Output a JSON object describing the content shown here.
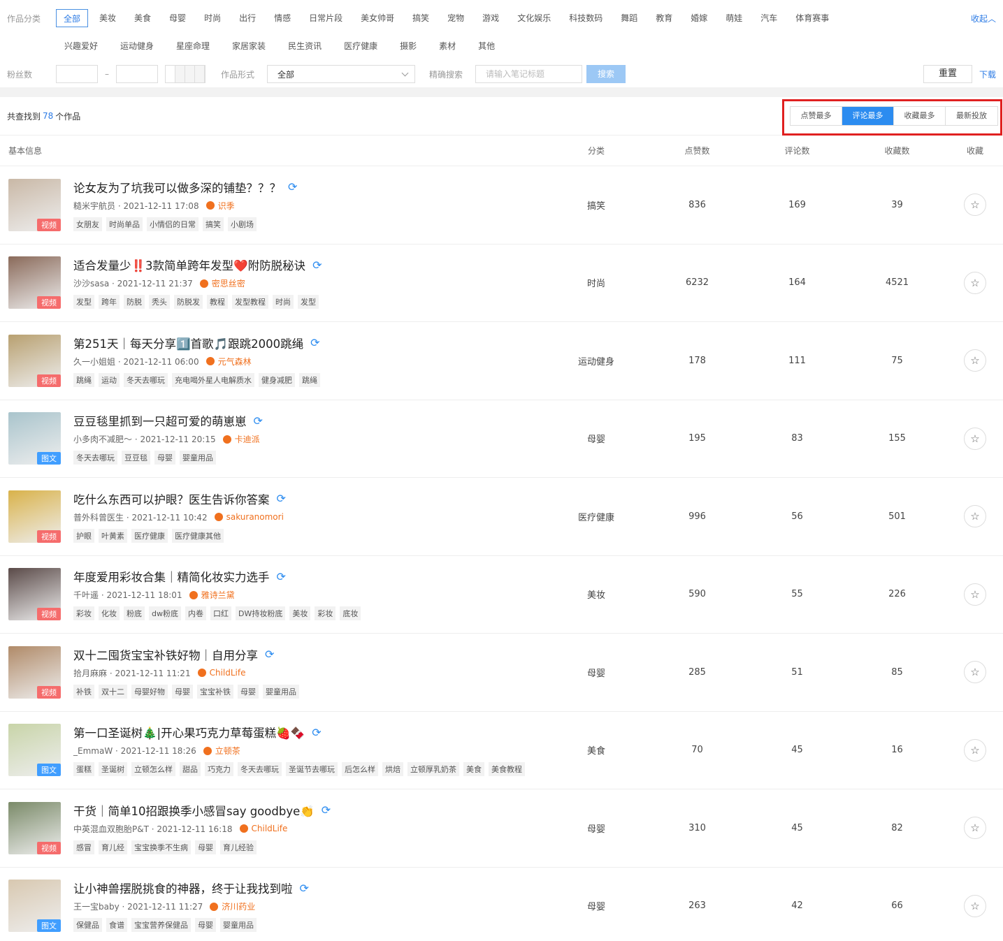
{
  "filter": {
    "category_label": "作品分类",
    "categories_row1": [
      "全部",
      "美妆",
      "美食",
      "母婴",
      "时尚",
      "出行",
      "情感",
      "日常片段",
      "美女帅哥",
      "搞笑",
      "宠物",
      "游戏",
      "文化娱乐",
      "科技数码",
      "舞蹈",
      "教育",
      "婚嫁",
      "萌娃",
      "汽车",
      "体育赛事"
    ],
    "categories_row2": [
      "兴趣爱好",
      "运动健身",
      "星座命理",
      "家居家装",
      "民生资讯",
      "医疗健康",
      "摄影",
      "素材",
      "其他"
    ],
    "active_category": "全部",
    "collapse_label": "收起︿",
    "fans_label": "粉丝数",
    "fans_min": "",
    "fans_max": "",
    "dash": "–",
    "form_label": "作品形式",
    "form_value": "全部",
    "precise_label": "精确搜索",
    "search_placeholder": "请输入笔记标题",
    "search_button": "搜索",
    "reset_button": "重置",
    "download_link": "下载"
  },
  "summary": {
    "prefix": "共查找到",
    "count": "78",
    "suffix": "个作品"
  },
  "sort": {
    "options": [
      "点赞最多",
      "评论最多",
      "收藏最多",
      "最新投放"
    ],
    "active": "评论最多"
  },
  "columns": [
    "基本信息",
    "分类",
    "点赞数",
    "评论数",
    "收藏数",
    "收藏"
  ],
  "rows": [
    {
      "title": "论女友为了坑我可以做多深的铺垫？？？",
      "author": "糙米宇航员 · 2021-12-11 17:08",
      "brand": "识季",
      "tags": [
        "女朋友",
        "时尚单品",
        "小情侣的日常",
        "搞笑",
        "小剧场"
      ],
      "category": "搞笑",
      "likes": "836",
      "comments": "169",
      "favorites": "39",
      "type": "视频",
      "thumb_color": "#c9b8a6"
    },
    {
      "title": "适合发量少‼️3款简单跨年发型❤️附防脱秘诀",
      "author": "沙沙sasa · 2021-12-11 21:37",
      "brand": "密思丝密",
      "tags": [
        "发型",
        "跨年",
        "防脱",
        "秃头",
        "防脱发",
        "教程",
        "发型教程",
        "时尚",
        "发型"
      ],
      "category": "时尚",
      "likes": "6232",
      "comments": "164",
      "favorites": "4521",
      "type": "视频",
      "thumb_color": "#8a6a5a"
    },
    {
      "title": "第251天｜每天分享1️⃣首歌🎵跟跳2000跳绳",
      "author": "久一小姐姐 · 2021-12-11 06:00",
      "brand": "元气森林",
      "tags": [
        "跳绳",
        "运动",
        "冬天去哪玩",
        "充电喝外星人电解质水",
        "健身减肥",
        "跳绳"
      ],
      "category": "运动健身",
      "likes": "178",
      "comments": "111",
      "favorites": "75",
      "type": "视频",
      "thumb_color": "#b8a070"
    },
    {
      "title": "豆豆毯里抓到一只超可爱的萌崽崽",
      "author": "小多肉不减肥～ · 2021-12-11 20:15",
      "brand": "卡迪派",
      "tags": [
        "冬天去哪玩",
        "豆豆毯",
        "母婴",
        "婴童用品"
      ],
      "category": "母婴",
      "likes": "195",
      "comments": "83",
      "favorites": "155",
      "type": "图文",
      "thumb_color": "#a9c4cc"
    },
    {
      "title": "吃什么东西可以护眼？医生告诉你答案",
      "author": "普外科曾医生 · 2021-12-11 10:42",
      "brand": "sakuranomori",
      "tags": [
        "护眼",
        "叶黄素",
        "医疗健康",
        "医疗健康其他"
      ],
      "category": "医疗健康",
      "likes": "996",
      "comments": "56",
      "favorites": "501",
      "type": "视频",
      "thumb_color": "#d9b24a"
    },
    {
      "title": "年度爱用彩妆合集｜精简化妆实力选手",
      "author": "千叶遥 · 2021-12-11 18:01",
      "brand": "雅诗兰黛",
      "tags": [
        "彩妆",
        "化妆",
        "粉底",
        "dw粉底",
        "内卷",
        "口红",
        "DW持妆粉底",
        "美妆",
        "彩妆",
        "底妆"
      ],
      "category": "美妆",
      "likes": "590",
      "comments": "55",
      "favorites": "226",
      "type": "视频",
      "thumb_color": "#5a4a48"
    },
    {
      "title": "双十二囤货宝宝补铁好物｜自用分享",
      "author": "拾月麻麻 · 2021-12-11 11:21",
      "brand": "ChildLife",
      "tags": [
        "补铁",
        "双十二",
        "母婴好物",
        "母婴",
        "宝宝补铁",
        "母婴",
        "婴童用品"
      ],
      "category": "母婴",
      "likes": "285",
      "comments": "51",
      "favorites": "85",
      "type": "视频",
      "thumb_color": "#b08a68"
    },
    {
      "title": "第一口圣诞树🎄|开心果巧克力草莓蛋糕🍓🍫",
      "author": "_EmmaW · 2021-12-11 18:26",
      "brand": "立顿茶",
      "tags": [
        "蛋糕",
        "圣诞树",
        "立顿怎么样",
        "甜品",
        "巧克力",
        "冬天去哪玩",
        "圣诞节去哪玩",
        "后怎么样",
        "烘焙",
        "立顿厚乳奶茶",
        "美食",
        "美食教程"
      ],
      "category": "美食",
      "likes": "70",
      "comments": "45",
      "favorites": "16",
      "type": "图文",
      "thumb_color": "#c8d4a8"
    },
    {
      "title": "干货｜简单10招跟换季小感冒say goodbye👏",
      "author": "中英混血双胞胎P&T · 2021-12-11 16:18",
      "brand": "ChildLife",
      "tags": [
        "感冒",
        "育儿经",
        "宝宝换季不生病",
        "母婴",
        "育儿经验"
      ],
      "category": "母婴",
      "likes": "310",
      "comments": "45",
      "favorites": "82",
      "type": "视频",
      "thumb_color": "#7a8a68"
    },
    {
      "title": "让小神兽摆脱挑食的神器，终于让我找到啦",
      "author": "王一宝baby · 2021-12-11 11:27",
      "brand": "济川药业",
      "tags": [
        "保健品",
        "食谱",
        "宝宝营养保健品",
        "母婴",
        "婴童用品"
      ],
      "category": "母婴",
      "likes": "263",
      "comments": "42",
      "favorites": "66",
      "type": "图文",
      "thumb_color": "#d8c8b0"
    }
  ],
  "icons": {
    "refresh": "refresh-icon",
    "star": "star-icon",
    "brand": "brand-badge-icon",
    "chevron": "chevron-down-icon"
  }
}
